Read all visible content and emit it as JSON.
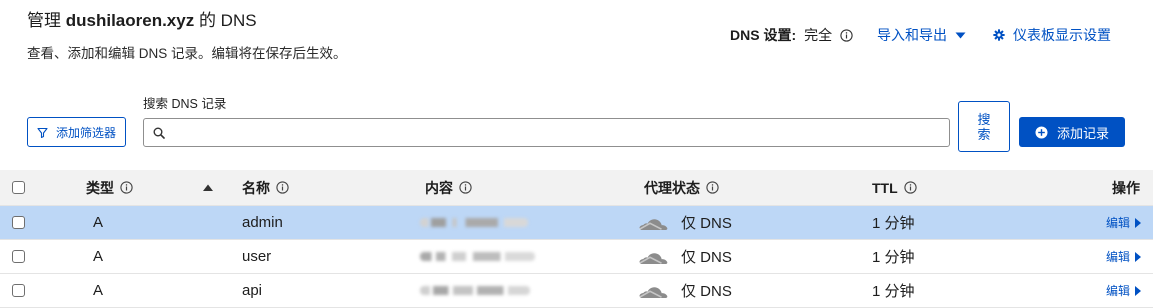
{
  "header": {
    "title_prefix": "管理",
    "title_domain": "dushilaoren.xyz",
    "title_suffix": "的 DNS",
    "subtitle": "查看、添加和编辑 DNS 记录。编辑将在保存后生效。",
    "dns_setting_label": "DNS 设置:",
    "dns_setting_value": "完全",
    "import_export_label": "导入和导出",
    "dashboard_settings_label": "仪表板显示设置"
  },
  "toolbar": {
    "filter_button_label": "添加筛选器",
    "search_label": "搜索 DNS 记录",
    "search_value": "",
    "search_button_label": "搜索",
    "add_record_label": "添加记录"
  },
  "table": {
    "columns": {
      "type": "类型",
      "name": "名称",
      "content": "内容",
      "proxy_status": "代理状态",
      "ttl": "TTL",
      "actions": "操作"
    },
    "sort_icon": "sort-ascending-icon",
    "rows": [
      {
        "checked": false,
        "highlighted": true,
        "type": "A",
        "name": "admin",
        "proxy_icon": "grey-cloud-icon",
        "proxy_status": "仅 DNS",
        "ttl": "1 分钟",
        "action_label": "编辑"
      },
      {
        "checked": false,
        "highlighted": false,
        "type": "A",
        "name": "user",
        "proxy_icon": "grey-cloud-icon",
        "proxy_status": "仅 DNS",
        "ttl": "1 分钟",
        "action_label": "编辑"
      },
      {
        "checked": false,
        "highlighted": false,
        "type": "A",
        "name": "api",
        "proxy_icon": "grey-cloud-icon",
        "proxy_status": "仅 DNS",
        "ttl": "1 分钟",
        "action_label": "编辑"
      }
    ]
  },
  "icons": {
    "info": "info-icon",
    "import_export_caret": "caret-down-icon",
    "dashboard_settings": "gear-icon",
    "filter": "filter-icon",
    "search": "search-icon",
    "add_record": "plus-circle-icon",
    "edit_chevron": "caret-right-icon",
    "checkbox": "checkbox-icon"
  },
  "colors": {
    "accent": "#0051c3",
    "row_highlight": "#bdd7f6",
    "header_bg": "#f2f2f2",
    "proxy_cloud": "#8c8c8c"
  }
}
